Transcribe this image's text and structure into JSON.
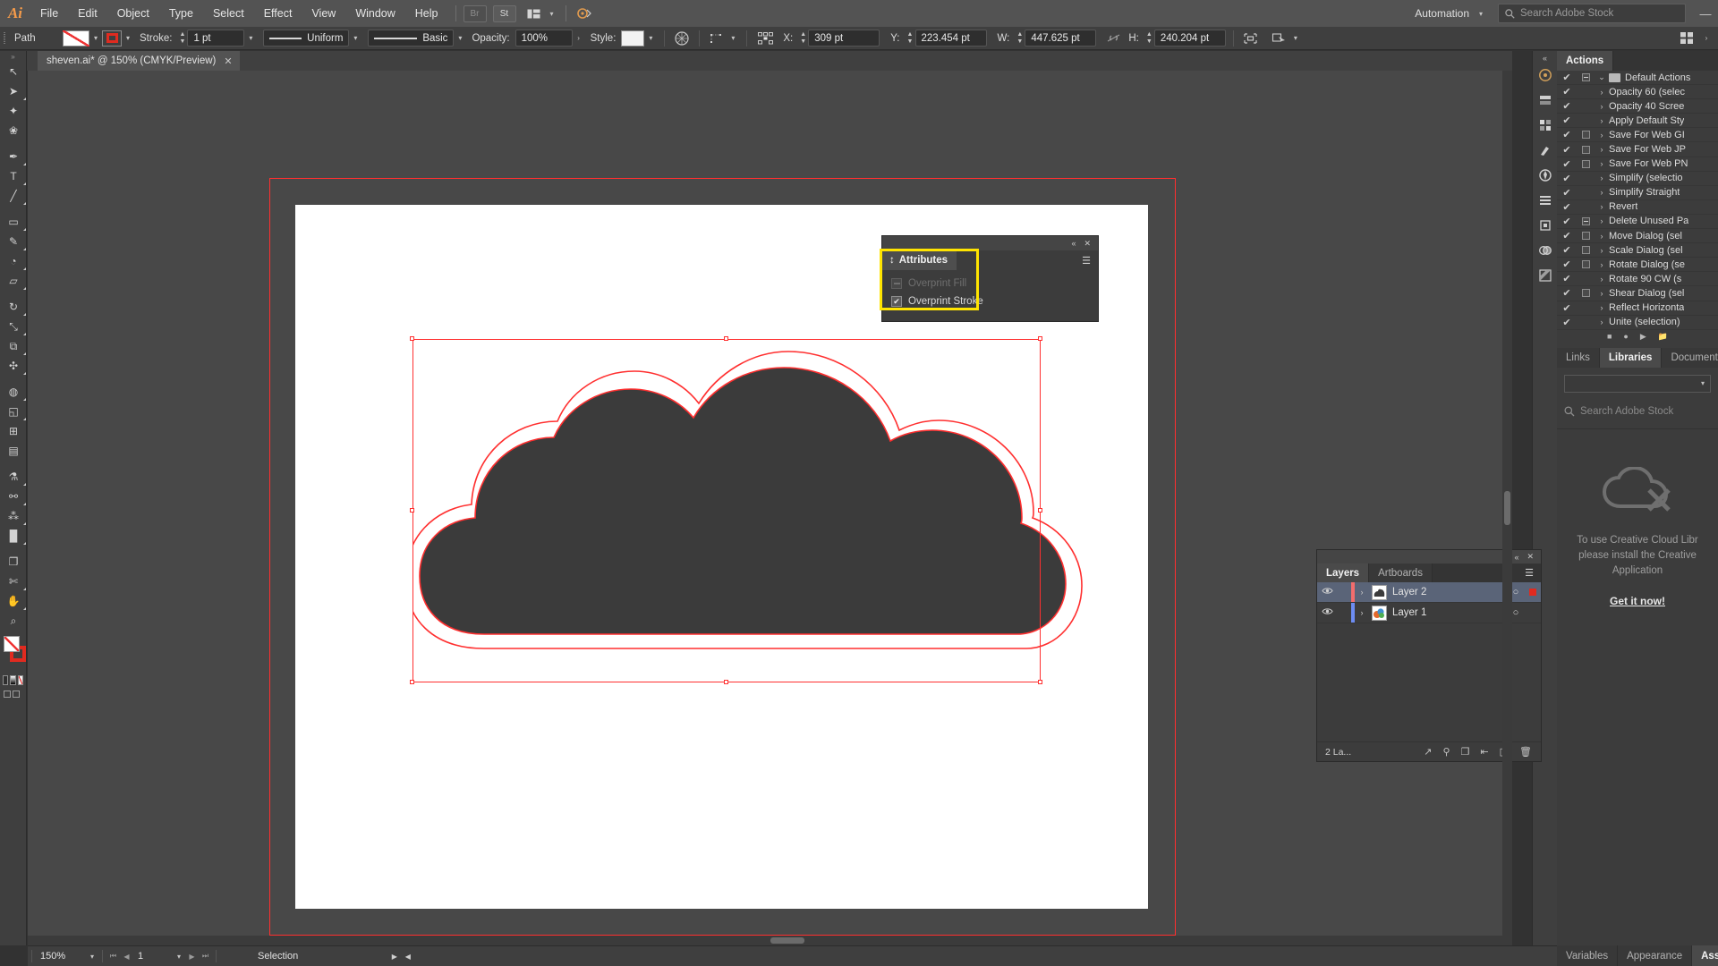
{
  "app": {
    "name": "Ai",
    "logo_color": "#f59b4a"
  },
  "menubar": {
    "items": [
      "File",
      "Edit",
      "Object",
      "Type",
      "Select",
      "Effect",
      "View",
      "Window",
      "Help"
    ],
    "bridge_label": "Br",
    "stock_label": "St",
    "arrange_icon": "arrange-documents-icon",
    "workspace_icon": "workspace-switcher-icon",
    "automation_label": "Automation",
    "search_placeholder": "Search Adobe Stock",
    "minimize_label": "—"
  },
  "controlbar": {
    "object_label": "Path",
    "fill_label": "fill-swatch",
    "stroke_swatch_label": "stroke-swatch",
    "stroke_label": "Stroke:",
    "stroke_weight": "1 pt",
    "profile_label": "Uniform",
    "brush_label": "Basic",
    "opacity_label": "Opacity:",
    "opacity_value": "100%",
    "style_label": "Style:",
    "recolor_icon": "recolor-artwork-icon",
    "transform_icon": "transform-icon",
    "align_icon": "align-icon",
    "x_label": "X:",
    "x_value": "309 pt",
    "y_label": "Y:",
    "y_value": "223.454 pt",
    "w_label": "W:",
    "w_value": "447.625 pt",
    "link_icon": "constrain-proportions-icon",
    "h_label": "H:",
    "h_value": "240.204 pt",
    "isolate_icon": "isolate-selected-object-icon",
    "mask_icon": "edit-clipping-mask-icon",
    "panel_grid_icon": "panel-grid-icon",
    "more_caret": "›"
  },
  "document": {
    "tab_title": "sheven.ai* @ 150% (CMYK/Preview)",
    "close_label": "✕"
  },
  "toolbar": {
    "tools": [
      {
        "name": "selection-tool",
        "glyph": "↖",
        "selected": false,
        "has_flyout": false
      },
      {
        "name": "direct-selection-tool",
        "glyph": "➤",
        "selected": false,
        "has_flyout": true
      },
      {
        "name": "magic-wand-tool",
        "glyph": "✦",
        "selected": false,
        "has_flyout": false
      },
      {
        "name": "lasso-tool",
        "glyph": "❀",
        "selected": false,
        "has_flyout": false
      },
      {
        "name": "pen-tool",
        "glyph": "✒",
        "selected": false,
        "has_flyout": true
      },
      {
        "name": "type-tool",
        "glyph": "T",
        "selected": false,
        "has_flyout": true
      },
      {
        "name": "line-segment-tool",
        "glyph": "╱",
        "selected": false,
        "has_flyout": true
      },
      {
        "name": "rectangle-tool",
        "glyph": "▭",
        "selected": false,
        "has_flyout": true
      },
      {
        "name": "paintbrush-tool",
        "glyph": "✎",
        "selected": false,
        "has_flyout": true
      },
      {
        "name": "shaper-tool",
        "glyph": "◔",
        "selected": false,
        "has_flyout": true
      },
      {
        "name": "eraser-tool",
        "glyph": "▱",
        "selected": false,
        "has_flyout": true
      },
      {
        "name": "rotate-tool",
        "glyph": "↻",
        "selected": false,
        "has_flyout": true
      },
      {
        "name": "scale-tool",
        "glyph": "⤡",
        "selected": false,
        "has_flyout": true
      },
      {
        "name": "width-tool",
        "glyph": "⧉",
        "selected": false,
        "has_flyout": true
      },
      {
        "name": "free-transform-tool",
        "glyph": "✣",
        "selected": false,
        "has_flyout": true
      },
      {
        "name": "shape-builder-tool",
        "glyph": "◍",
        "selected": false,
        "has_flyout": true
      },
      {
        "name": "perspective-grid-tool",
        "glyph": "◱",
        "selected": false,
        "has_flyout": true
      },
      {
        "name": "mesh-tool",
        "glyph": "⊞",
        "selected": false,
        "has_flyout": false
      },
      {
        "name": "gradient-tool",
        "glyph": "▤",
        "selected": false,
        "has_flyout": false
      },
      {
        "name": "eyedropper-tool",
        "glyph": "⚗",
        "selected": false,
        "has_flyout": true
      },
      {
        "name": "blend-tool",
        "glyph": "⚯",
        "selected": false,
        "has_flyout": true
      },
      {
        "name": "symbol-sprayer-tool",
        "glyph": "⁂",
        "selected": false,
        "has_flyout": true
      },
      {
        "name": "column-graph-tool",
        "glyph": "█",
        "selected": false,
        "has_flyout": true
      },
      {
        "name": "artboard-tool",
        "glyph": "❐",
        "selected": false,
        "has_flyout": false
      },
      {
        "name": "slice-tool",
        "glyph": "✄",
        "selected": false,
        "has_flyout": true
      },
      {
        "name": "hand-tool",
        "glyph": "✋",
        "selected": false,
        "has_flyout": true
      },
      {
        "name": "zoom-tool",
        "glyph": "⌕",
        "selected": false,
        "has_flyout": false
      }
    ],
    "fill_name": "fill-color-none",
    "stroke_name": "stroke-color-red",
    "color_modes": [
      "color-swatch",
      "gradient-swatch",
      "none-swatch"
    ],
    "screen_modes": [
      "normal-screen-mode",
      "full-screen-menu-mode",
      "full-screen-mode"
    ]
  },
  "attributes_panel": {
    "collapse_label": "«",
    "close_label": "✕",
    "tab_label": "Attributes",
    "menu_label": "☰",
    "overprint_fill_label": "Overprint Fill",
    "overprint_fill_checked": false,
    "overprint_fill_enabled": false,
    "overprint_stroke_label": "Overprint Stroke",
    "overprint_stroke_checked": true,
    "check_glyph": "✔",
    "highlight_color": "#ffe400"
  },
  "actions_panel": {
    "tab_label": "Actions",
    "items": [
      {
        "check": "✔",
        "box": "minus",
        "arrow": "⌄",
        "is_folder": true,
        "name": "Default Actions"
      },
      {
        "check": "✔",
        "box": "none",
        "arrow": "›",
        "is_folder": false,
        "name": "Opacity 60 (selec"
      },
      {
        "check": "✔",
        "box": "none",
        "arrow": "›",
        "is_folder": false,
        "name": "Opacity 40 Scree"
      },
      {
        "check": "✔",
        "box": "none",
        "arrow": "›",
        "is_folder": false,
        "name": "Apply Default Sty"
      },
      {
        "check": "✔",
        "box": "empty",
        "arrow": "›",
        "is_folder": false,
        "name": "Save For Web GI"
      },
      {
        "check": "✔",
        "box": "empty",
        "arrow": "›",
        "is_folder": false,
        "name": "Save For Web JP"
      },
      {
        "check": "✔",
        "box": "empty",
        "arrow": "›",
        "is_folder": false,
        "name": "Save For Web PN"
      },
      {
        "check": "✔",
        "box": "none",
        "arrow": "›",
        "is_folder": false,
        "name": "Simplify (selectio"
      },
      {
        "check": "✔",
        "box": "none",
        "arrow": "›",
        "is_folder": false,
        "name": "Simplify Straight"
      },
      {
        "check": "✔",
        "box": "none",
        "arrow": "›",
        "is_folder": false,
        "name": "Revert"
      },
      {
        "check": "✔",
        "box": "minus",
        "arrow": "›",
        "is_folder": false,
        "name": "Delete Unused Pa"
      },
      {
        "check": "✔",
        "box": "empty",
        "arrow": "›",
        "is_folder": false,
        "name": "Move Dialog (sel"
      },
      {
        "check": "✔",
        "box": "empty",
        "arrow": "›",
        "is_folder": false,
        "name": "Scale Dialog (sel"
      },
      {
        "check": "✔",
        "box": "empty",
        "arrow": "›",
        "is_folder": false,
        "name": "Rotate Dialog (se"
      },
      {
        "check": "✔",
        "box": "none",
        "arrow": "›",
        "is_folder": false,
        "name": "Rotate 90 CW (s"
      },
      {
        "check": "✔",
        "box": "empty",
        "arrow": "›",
        "is_folder": false,
        "name": "Shear Dialog (sel"
      },
      {
        "check": "✔",
        "box": "none",
        "arrow": "›",
        "is_folder": false,
        "name": "Reflect Horizonta"
      },
      {
        "check": "✔",
        "box": "none",
        "arrow": "›",
        "is_folder": false,
        "name": "Unite (selection)"
      }
    ],
    "footer_icons": [
      "stop-playing-icon",
      "begin-recording-icon",
      "play-current-selection-icon",
      "create-new-set-icon"
    ]
  },
  "libraries_panel": {
    "tabs": [
      {
        "label": "Links",
        "active": false
      },
      {
        "label": "Libraries",
        "active": true
      },
      {
        "label": "Document In",
        "active": false
      }
    ],
    "library_select_value": "",
    "search_placeholder": "Search Adobe Stock",
    "search_icon": "search-icon",
    "cc_icon": "creative-cloud-unavailable-icon",
    "message_lines": [
      "To use Creative Cloud Libr",
      "please install the Creative",
      "Application"
    ],
    "link_label": "Get it now!"
  },
  "layers_panel": {
    "collapse_label": "«",
    "close_label": "✕",
    "tabs": [
      {
        "label": "Layers",
        "active": true
      },
      {
        "label": "Artboards",
        "active": false
      }
    ],
    "menu_label": "☰",
    "layers": [
      {
        "name": "Layer 2",
        "visible": true,
        "eye_icon": "eye-icon",
        "color": "#f26d6d",
        "arrow": "›",
        "selected": true,
        "target_glyph": "○",
        "has_selection_square": true
      },
      {
        "name": "Layer 1",
        "visible": true,
        "eye_icon": "eye-icon",
        "color": "#6d8cf2",
        "arrow": "›",
        "selected": false,
        "target_glyph": "○",
        "has_selection_square": false
      }
    ],
    "count_label": "2 La...",
    "footer_icons": [
      "collect-for-export-icon",
      "locate-object-icon",
      "make-clipping-mask-icon",
      "create-new-sublayer-icon",
      "create-new-layer-icon",
      "delete-selection-icon"
    ]
  },
  "dock_bottom_tabs": [
    {
      "label": "Variables",
      "active": false
    },
    {
      "label": "Appearance",
      "active": false
    },
    {
      "label": "Asset E",
      "active": true
    }
  ],
  "dock_collapse_icons": [
    "color-panel-icon",
    "color-guide-panel-icon",
    "swatches-panel-icon",
    "brushes-panel-icon",
    "symbols-panel-icon",
    "align-panel-icon",
    "transform-panel-icon",
    "pathfinder-panel-icon",
    "transparency-panel-icon"
  ],
  "statusbar": {
    "zoom_value": "150%",
    "first_page_icon": "first-artboard-icon",
    "prev_page_icon": "previous-artboard-icon",
    "artboard_value": "1",
    "next_page_icon": "next-artboard-icon",
    "last_page_icon": "last-artboard-icon",
    "status_text": "Selection",
    "play_icon": "play-icon",
    "prev_icon": "previous-icon"
  },
  "artwork": {
    "shape_name": "cloud-shape",
    "fill_color": "#3b3b3b",
    "stroke_color": "#ff2f2f",
    "selection_color": "#ff2f2f"
  }
}
